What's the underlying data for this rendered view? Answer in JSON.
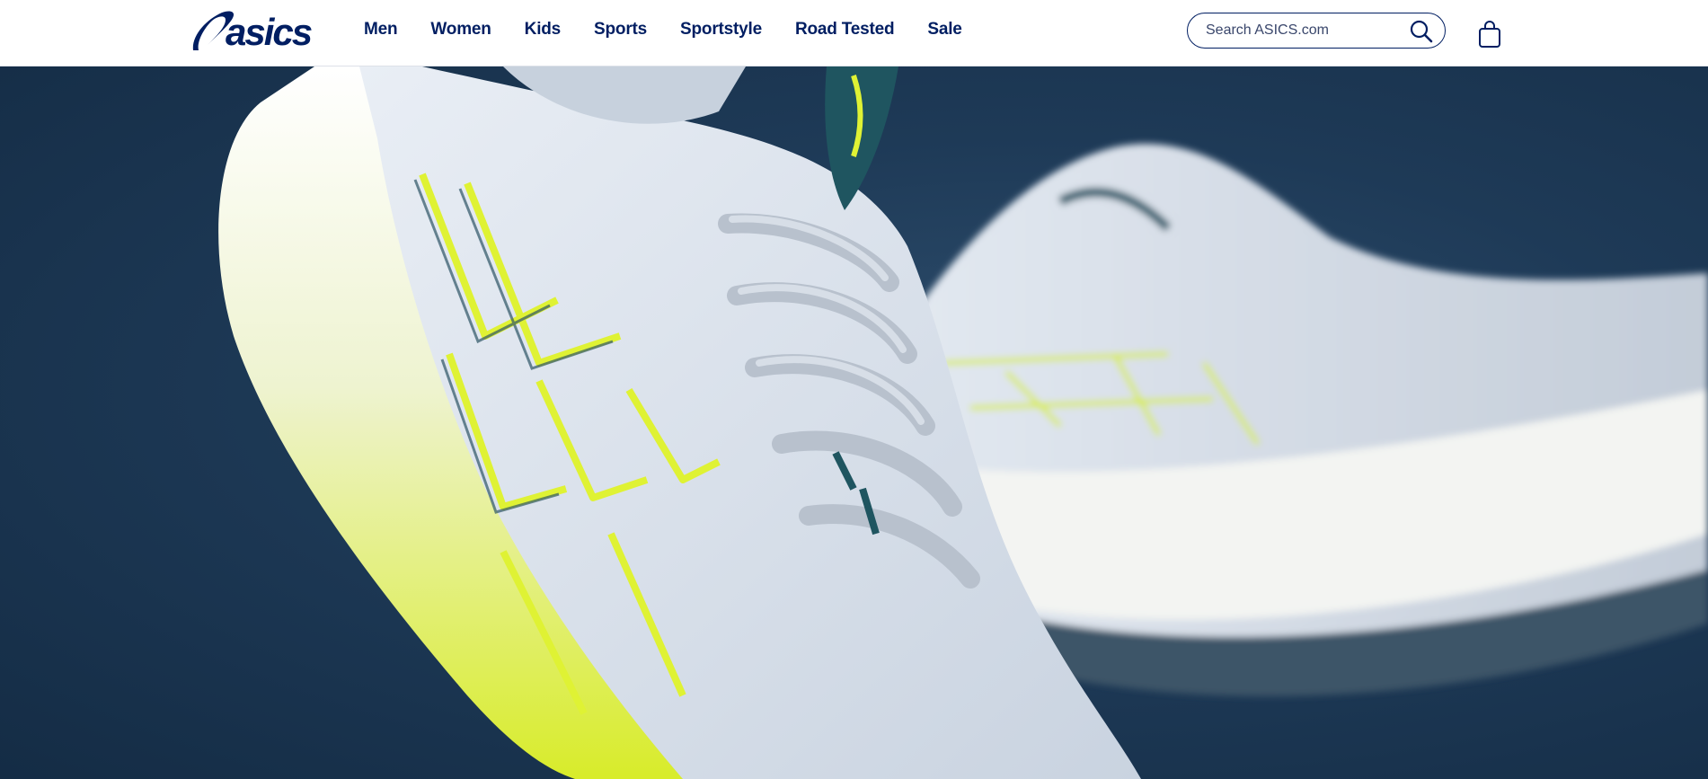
{
  "brand": {
    "logo_text": "asics",
    "color": "#001e62"
  },
  "nav": {
    "items": [
      {
        "label": "Men"
      },
      {
        "label": "Women"
      },
      {
        "label": "Kids"
      },
      {
        "label": "Sports"
      },
      {
        "label": "Sportstyle"
      },
      {
        "label": "Road Tested"
      },
      {
        "label": "Sale"
      }
    ]
  },
  "search": {
    "placeholder": "Search ASICS.com",
    "icon": "search-icon"
  },
  "cart": {
    "icon": "shopping-bag-icon"
  },
  "hero": {
    "background_color": "#1e3a57",
    "accent_color": "#dff234",
    "shoe_color": "#dde5ef"
  }
}
